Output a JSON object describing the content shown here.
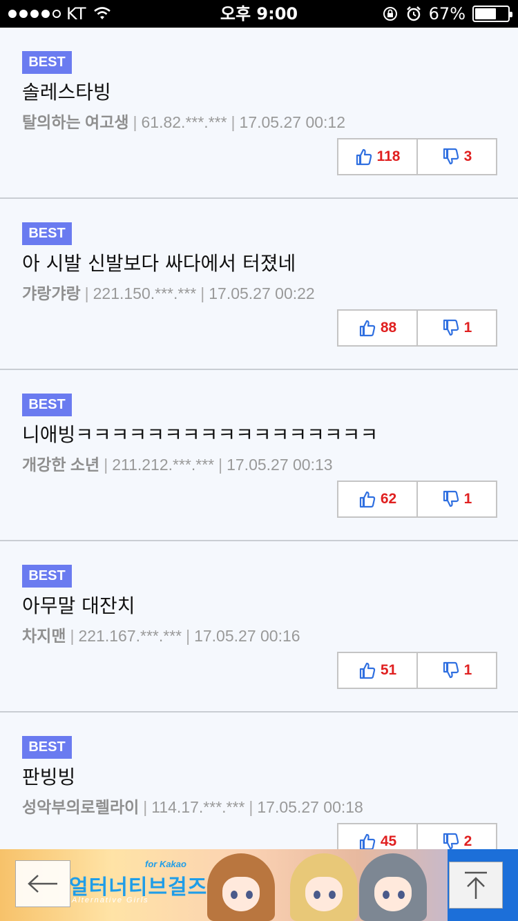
{
  "status_bar": {
    "carrier": "KT",
    "time": "오후 9:00",
    "battery": "67%",
    "battery_level": 0.67
  },
  "comments": [
    {
      "badge": "BEST",
      "text": "솔레스타빙",
      "author": "탈의하는 여고생",
      "ip": "61.82.***.***",
      "datetime": "17.05.27 00:12",
      "likes": "118",
      "dislikes": "3"
    },
    {
      "badge": "BEST",
      "text": "아 시발 신발보다 싸다에서 터졌네",
      "author": "갸랑갸랑",
      "ip": "221.150.***.***",
      "datetime": "17.05.27 00:22",
      "likes": "88",
      "dislikes": "1"
    },
    {
      "badge": "BEST",
      "text": "니애빙ㅋㅋㅋㅋㅋㅋㅋㅋㅋㅋㅋㅋㅋㅋㅋㅋㅋ",
      "author": "개강한 소년",
      "ip": "211.212.***.***",
      "datetime": "17.05.27 00:13",
      "likes": "62",
      "dislikes": "1"
    },
    {
      "badge": "BEST",
      "text": "아무말 대잔치",
      "author": "차지맨",
      "ip": "221.167.***.***",
      "datetime": "17.05.27 00:16",
      "likes": "51",
      "dislikes": "1"
    },
    {
      "badge": "BEST",
      "text": "판빙빙",
      "author": "성악부의로렐라이",
      "ip": "114.17.***.***",
      "datetime": "17.05.27 00:18",
      "likes": "45",
      "dislikes": "2"
    }
  ],
  "meta_separator": "|",
  "ad": {
    "title": "얼터너티브걸즈",
    "for_label": "for Kakao",
    "subtitle": "Alternative Girls"
  },
  "icons": {
    "like": "thumbs-up-icon",
    "dislike": "thumbs-down-icon",
    "back": "left-arrow-icon",
    "top": "scroll-top-icon"
  },
  "colors": {
    "badge": "#6a7bf0",
    "vote_count": "#e02020",
    "thumb": "#2f6fe0",
    "top_panel": "#1c6fd9"
  }
}
